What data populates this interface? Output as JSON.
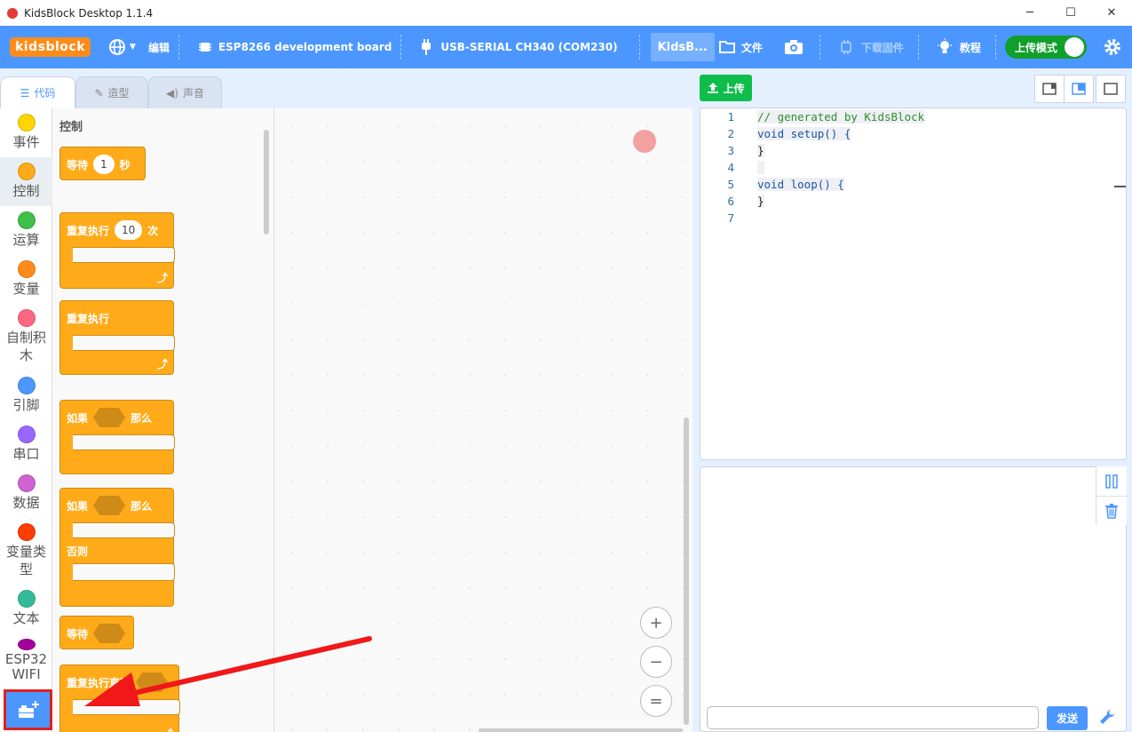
{
  "window": {
    "title": "KidsBlock Desktop 1.1.4",
    "minimize": "─",
    "maximize": "☐",
    "close": "✕"
  },
  "menubar": {
    "logo": "kidsblock",
    "edit": "编辑",
    "board": "ESP8266 development board",
    "port": "USB-SERIAL CH340 (COM230)",
    "kidsb_tab": "KidsB...",
    "file": "文件",
    "firmware": "下载固件",
    "tutorial": "教程",
    "upload_mode": "上传模式"
  },
  "tabs": {
    "code": "代码",
    "costume": "造型",
    "sound": "声音"
  },
  "categories": [
    {
      "label": "事件",
      "color": "#ffd500"
    },
    {
      "label": "控制",
      "color": "#ffab19"
    },
    {
      "label": "运算",
      "color": "#40bf4a"
    },
    {
      "label": "变量",
      "color": "#ff8c1a"
    },
    {
      "label": "自制积木",
      "color": "#ff6680"
    },
    {
      "label": "引脚",
      "color": "#4c97ff"
    },
    {
      "label": "串口",
      "color": "#9966ff"
    },
    {
      "label": "数据",
      "color": "#cf63cf"
    },
    {
      "label": "变量类型",
      "color": "#ff3d00"
    },
    {
      "label": "文本",
      "color": "#33bb99"
    },
    {
      "label": "ESP32 WIFI",
      "color": "#a4009a"
    }
  ],
  "palette": {
    "heading": "控制",
    "wait_label": "等待",
    "wait_value": "1",
    "wait_unit": "秒",
    "repeat_label": "重复执行",
    "repeat_value": "10",
    "repeat_unit": "次",
    "forever": "重复执行",
    "if": "如果",
    "then": "那么",
    "else": "否则",
    "wait_until": "等待",
    "repeat_until": "重复执行直到"
  },
  "zoom": {
    "in": "+",
    "out": "−",
    "reset": "="
  },
  "right": {
    "upload": "上传",
    "send": "发送"
  },
  "code": [
    {
      "n": "1",
      "text": "// generated by KidsBlock",
      "type": "comment"
    },
    {
      "n": "2",
      "text": "void setup() {",
      "type": "code"
    },
    {
      "n": "3",
      "text": "}",
      "type": "code"
    },
    {
      "n": "4",
      "text": " ",
      "type": "code"
    },
    {
      "n": "5",
      "text": "void loop() {",
      "type": "code"
    },
    {
      "n": "6",
      "text": "}",
      "type": "code"
    },
    {
      "n": "7",
      "text": "",
      "type": "code"
    }
  ]
}
